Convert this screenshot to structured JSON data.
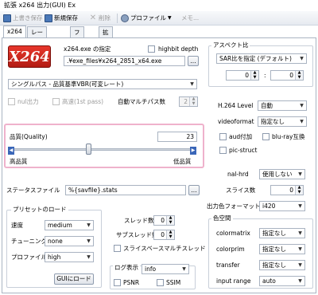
{
  "window": {
    "title": "拡張 x264 出力(GUI) Ex"
  },
  "toolbar": {
    "overwrite_save": "上書き保存",
    "new_save": "新規保存",
    "delete": "削除",
    "profile": "プロファイル",
    "memo": "メモ..."
  },
  "tabs": [
    "x264",
    "レート・QP制御",
    "フレーム",
    "拡張"
  ],
  "x264": {
    "logo_text": "X264",
    "exe_label": "x264.exe の指定",
    "exe_path": ".¥exe_files¥x264_2851_x64.exe",
    "browse": "...",
    "highbit_label": "highbit depth"
  },
  "mode": {
    "value": "シングルパス - 品質基準VBR(可変レート)"
  },
  "nul_label": "nul出力",
  "fast_label": "高速(1st pass)",
  "multipass": {
    "label": "自動マルチパス数",
    "value": "2"
  },
  "quality": {
    "label": "品質(Quality)",
    "value": "23",
    "high_label": "高品質",
    "low_label": "低品質",
    "left_btn": "◀",
    "right_btn": "▶",
    "slider_fraction": 0.42
  },
  "stats": {
    "label": "ステータスファイル",
    "value": "%{savfile}.stats",
    "browse": "..."
  },
  "preset": {
    "title": "プリセットのロード",
    "speed_label": "速度",
    "speed_value": "medium",
    "tuning_label": "チューニング",
    "tuning_value": "none",
    "profile_label": "プロファイル",
    "profile_value": "high",
    "gui_load": "GUIにロード"
  },
  "threads": {
    "thread_label": "スレッド数",
    "thread_value": "0",
    "subthread_label": "サブスレッド数",
    "subthread_value": "0",
    "slice_mt_label": "スライスベースマルチスレッド"
  },
  "log": {
    "title": "ログ表示",
    "value": "info",
    "psnr_label": "PSNR",
    "ssim_label": "SSIM"
  },
  "aspect": {
    "title": "アスペクト比",
    "mode": "SAR比を指定 (デフォルト)",
    "w": "0",
    "colon": ":",
    "h": "0"
  },
  "right": {
    "level_label": "H.264 Level",
    "level_value": "自動",
    "videoformat_label": "videoformat",
    "videoformat_value": "指定なし",
    "aud_label": "aud付加",
    "bluray_label": "blu-ray互換",
    "picstruct_label": "pic-struct",
    "nalhrd_label": "nal-hrd",
    "nalhrd_value": "使用しない",
    "slices_label": "スライス数",
    "slices_value": "0",
    "outcsp_label": "出力色フォーマット",
    "outcsp_value": "i420"
  },
  "colorspace": {
    "title": "色空間",
    "colormatrix_label": "colormatrix",
    "colormatrix_value": "指定なし",
    "colorprim_label": "colorprim",
    "colorprim_value": "指定なし",
    "transfer_label": "transfer",
    "transfer_value": "指定なし",
    "range_label": "input range",
    "range_value": "auto"
  }
}
